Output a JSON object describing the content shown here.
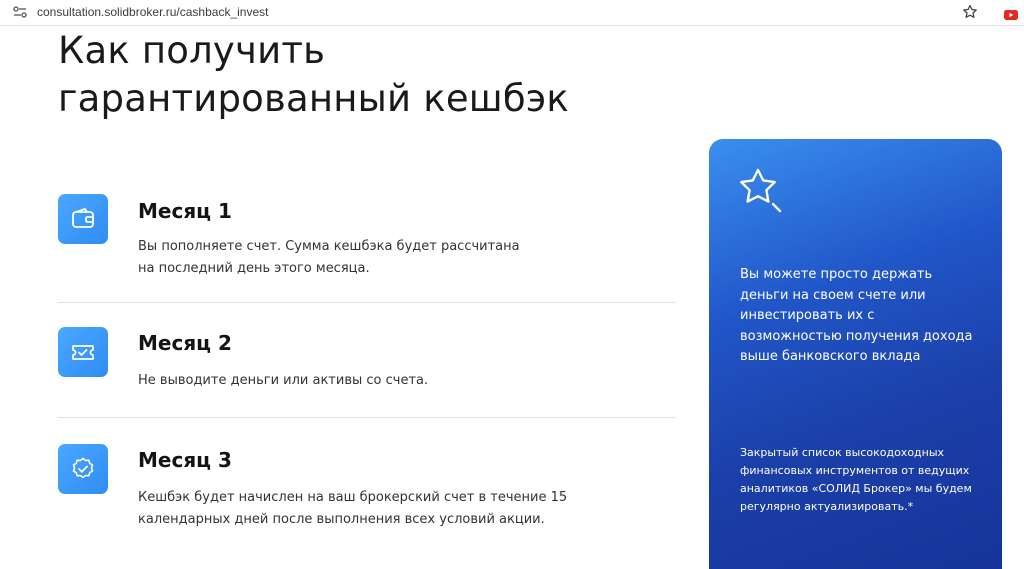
{
  "browser": {
    "url": "consultation.solidbroker.ru/cashback_invest"
  },
  "page": {
    "title_line1": "Как получить",
    "title_line2": "гарантированный кешбэк"
  },
  "steps": [
    {
      "icon": "wallet-icon",
      "title": "Месяц 1",
      "text_line1": "Вы пополняете счет. Сумма кешбэка будет рассчитана",
      "text_line2": "на последний день этого месяца."
    },
    {
      "icon": "ticket-check-icon",
      "title": "Месяц 2",
      "text_line1": "Не выводите деньги или активы со счета.",
      "text_line2": ""
    },
    {
      "icon": "badge-check-icon",
      "title": "Месяц 3",
      "text_line1": "Кешбэк будет начислен на ваш брокерский счет в течение 15",
      "text_line2": "календарных дней после выполнения всех условий акции."
    }
  ],
  "card": {
    "icon": "star-icon",
    "text": "Вы можете просто держать деньги на своем счете или инвестировать их с возможностью получения дохода выше банковского вклада",
    "note": "Закрытый список высокодоходных финансовых инструментов от ведущих аналитиков «СОЛИД Брокер» мы будем регулярно актуализировать.*"
  },
  "colors": {
    "accent": "#2f8cf4",
    "card_top": "#3a8ff0",
    "card_bottom": "#16349a"
  }
}
